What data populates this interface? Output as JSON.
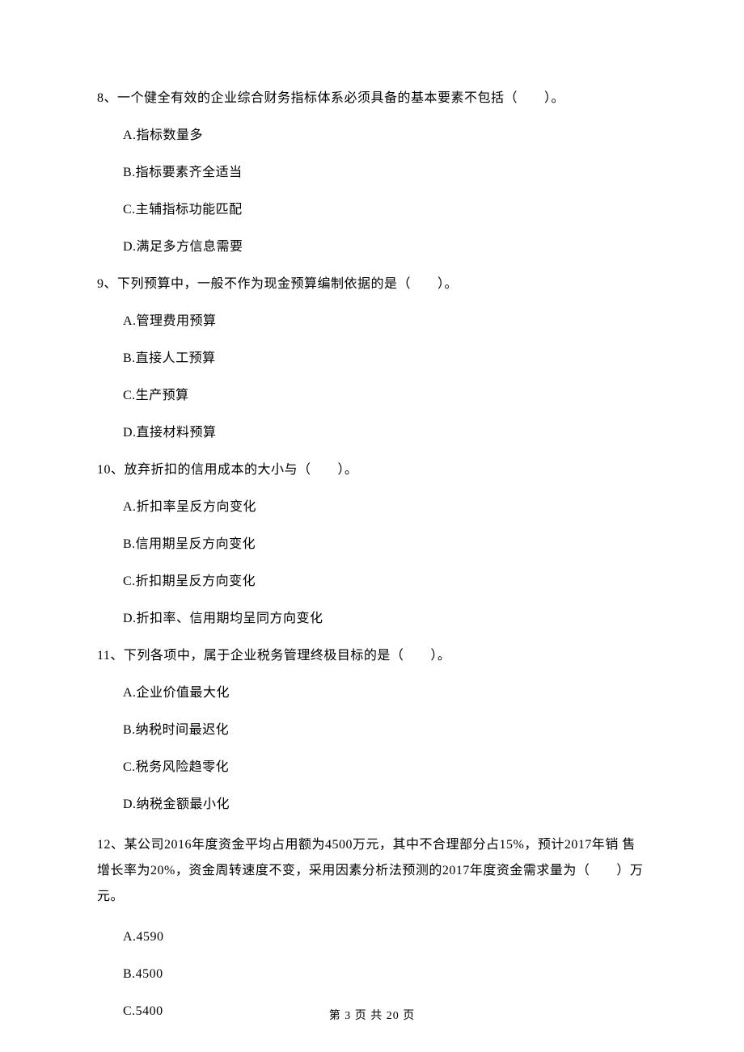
{
  "questions": [
    {
      "number": "8",
      "stem": "8、一个健全有效的企业综合财务指标体系必须具备的基本要素不包括（　　）。",
      "options": [
        "A.指标数量多",
        "B.指标要素齐全适当",
        "C.主辅指标功能匹配",
        "D.满足多方信息需要"
      ]
    },
    {
      "number": "9",
      "stem": "9、下列预算中，一般不作为现金预算编制依据的是（　　）。",
      "options": [
        "A.管理费用预算",
        "B.直接人工预算",
        "C.生产预算",
        "D.直接材料预算"
      ]
    },
    {
      "number": "10",
      "stem": "10、放弃折扣的信用成本的大小与（　　）。",
      "options": [
        "A.折扣率呈反方向变化",
        "B.信用期呈反方向变化",
        "C.折扣期呈反方向变化",
        "D.折扣率、信用期均呈同方向变化"
      ]
    },
    {
      "number": "11",
      "stem": "11、下列各项中，属于企业税务管理终极目标的是（　　）。",
      "options": [
        "A.企业价值最大化",
        "B.纳税时间最迟化",
        "C.税务风险趋零化",
        "D.纳税金额最小化"
      ]
    },
    {
      "number": "12",
      "stem": "12、某公司2016年度资金平均占用额为4500万元，其中不合理部分占15%，预计2017年销 售增长率为20%，资金周转速度不变，采用因素分析法预测的2017年度资金需求量为（　　）万元。",
      "options": [
        "A.4590",
        "B.4500",
        "C.5400"
      ]
    }
  ],
  "footer": "第 3 页 共 20 页"
}
